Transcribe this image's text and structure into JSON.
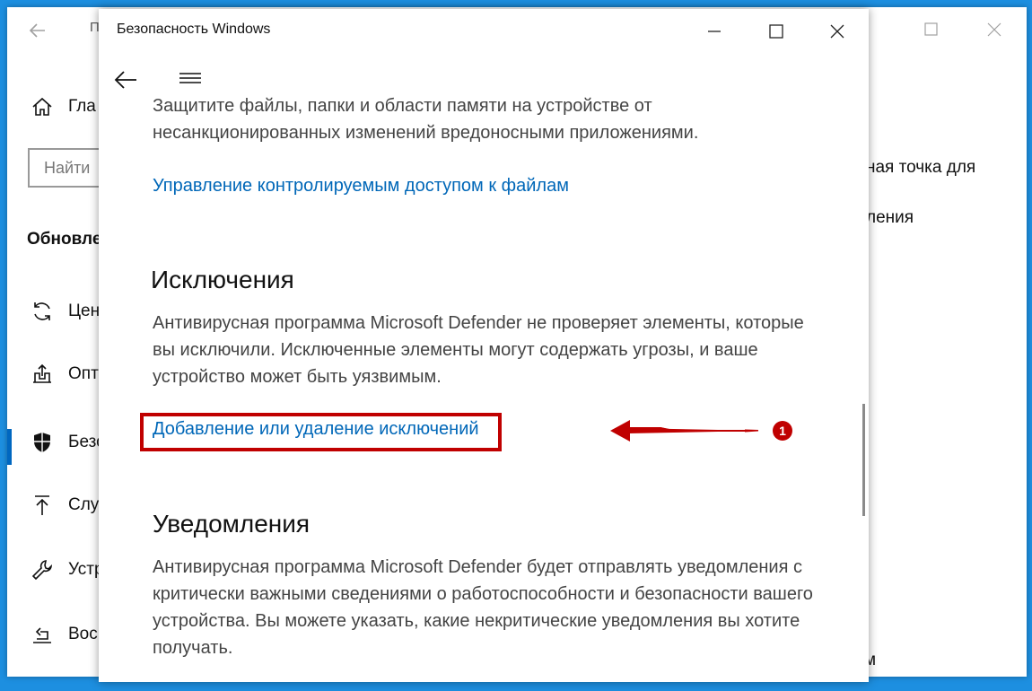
{
  "bg_window": {
    "title_partial": "П",
    "nav": [
      {
        "label_partial": "Гла",
        "icon": "home-icon"
      },
      {
        "label_partial": "Цен",
        "icon": "sync-icon"
      },
      {
        "label_partial": "Опт",
        "icon": "delivery-optimization-icon"
      },
      {
        "label_partial": "Безо",
        "icon": "shield-icon"
      },
      {
        "label_partial": "Слу",
        "icon": "upload-icon"
      },
      {
        "label_partial": "Устр",
        "icon": "wrench-icon"
      },
      {
        "label_partial": "Вос",
        "icon": "recovery-icon"
      }
    ],
    "search_placeholder_partial": "Найти",
    "section_partial": "Обновле",
    "right_text_1": "ная точка для",
    "right_text_2": "ления",
    "right_text_3": "м"
  },
  "window": {
    "title": "Безопасность Windows"
  },
  "content": {
    "intro_text": "Защитите файлы, папки и области памяти на устройстве от несанкционированных изменений вредоносными приложениями.",
    "cfa_link": "Управление контролируемым доступом к файлам",
    "exclusions_heading": "Исключения",
    "exclusions_text": "Антивирусная программа Microsoft Defender не проверяет элементы, которые вы исключили. Исключенные элементы могут содержать угрозы, и ваше устройство может быть уязвимым.",
    "exclusions_link": "Добавление или удаление исключений",
    "notifications_heading": "Уведомления",
    "notifications_text": "Антивирусная программа Microsoft Defender будет отправлять уведомления с критически важными сведениями о работоспособности и безопасности вашего устройства. Вы можете указать, какие некритические уведомления вы хотите получать."
  },
  "annotation": {
    "step_number": "1",
    "color": "#c00000"
  }
}
